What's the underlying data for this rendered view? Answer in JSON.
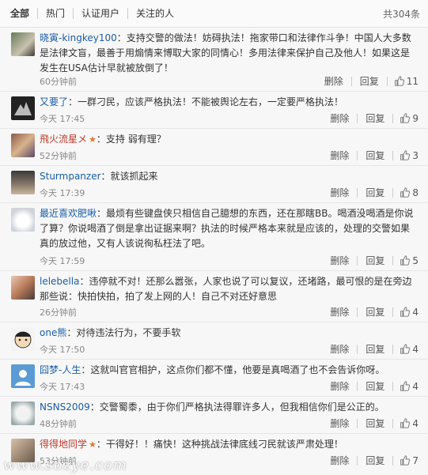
{
  "tabs": {
    "all": "全部",
    "hot": "热门",
    "verified": "认证用户",
    "following": "关注的人",
    "count": "共304条"
  },
  "actions": {
    "delete": "删除",
    "reply": "回复"
  },
  "comments": [
    {
      "name": "晓寅-kingkey100",
      "text": "：支持交警的做法！妨碍执法！拖家带口和法律作斗争！中国人大多数是法律文盲，最善于用煽情来博取大家的同情心！多用法律来保护自己及他人！如果这是发生在USA估计早就被放倒了！",
      "time": "60分钟前",
      "likes": "11"
    },
    {
      "name": "又要了",
      "text": "：一群刁民，应该严格执法！不能被舆论左右，一定要严格执法！",
      "time": "今天 17:45",
      "likes": "9"
    },
    {
      "name": "飛火流星メ",
      "text": "：支持 弱有理？",
      "time": "52分钟前",
      "likes": "3",
      "vip": true
    },
    {
      "name": "Sturmpanzer",
      "text": "：就该抓起来",
      "time": "今天 17:39",
      "likes": "8"
    },
    {
      "name": "最近喜欢肥啾",
      "text": "：最烦有些键盘侠只相信自己臆想的东西，还在那瞎BB。喝酒没喝酒是你说了算？你说喝酒了倒是拿出证据来啊？执法的时候严格本来就是应该的，处理的交警如果真的放过他，又有人该说徇私枉法了吧。",
      "time": "今天 17:59",
      "likes": "5"
    },
    {
      "name": "lelebella",
      "text": "：违停就不对！还那么嚣张，人家也说了可以复议，还堵路，最可恨的是在旁边那些说：快拍快拍，拍了发上网的人！自己不对还好意思",
      "time": "26分钟前",
      "likes": "4"
    },
    {
      "name": "one熊",
      "text": "：对待违法行为，不要手软",
      "time": "今天 17:50",
      "likes": "4"
    },
    {
      "name": "囧梦-人生",
      "text": "：这就叫官官相护，这点你们都不懂，他要是真喝酒了也不会告诉你呀。",
      "time": "今天 17:43",
      "likes": "4"
    },
    {
      "name": "NSNS2009",
      "text": "：交警蜀黍，由于你们严格执法得罪许多人，但我相信你们是公正的。",
      "time": "48分钟前",
      "likes": "4"
    },
    {
      "name": "得得地同学",
      "text": "：干得好！！痛快！这种挑战法律底线刁民就该严肃处理！",
      "time": "53分钟前",
      "likes": "7",
      "vip": true
    }
  ],
  "watermark": "www.sozye.com",
  "colors": {
    "link": "#1a5da8",
    "vip": "#e6752a"
  }
}
